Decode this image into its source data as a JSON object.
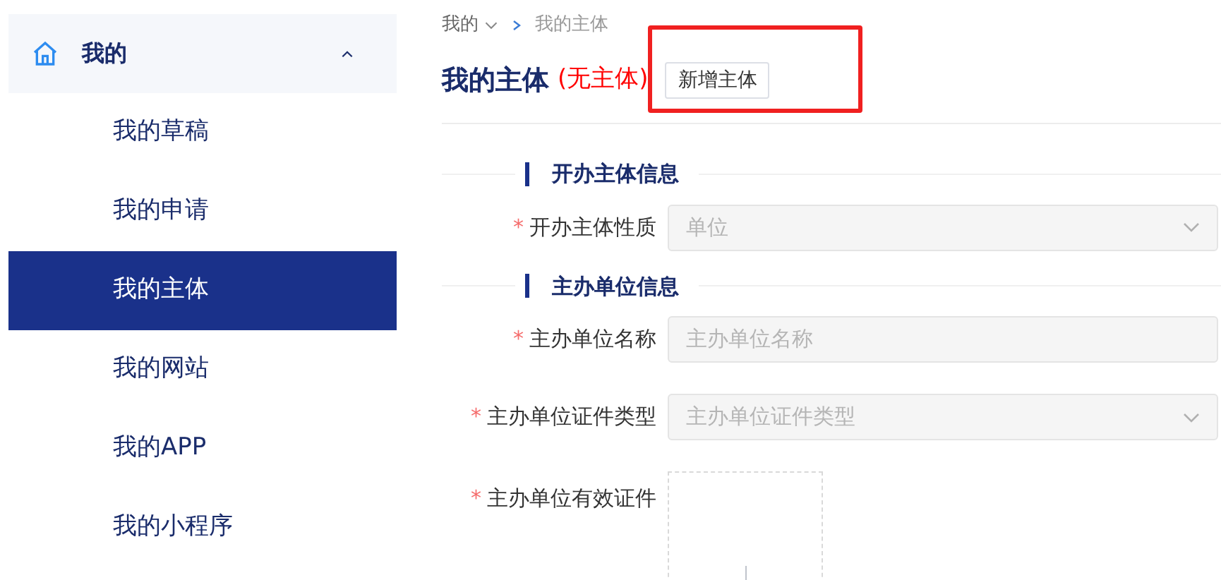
{
  "sidebar": {
    "group": {
      "label": "我的",
      "expanded": true
    },
    "items": [
      {
        "label": "我的草稿",
        "selected": false
      },
      {
        "label": "我的申请",
        "selected": false
      },
      {
        "label": "我的主体",
        "selected": true
      },
      {
        "label": "我的网站",
        "selected": false
      },
      {
        "label": "我的APP",
        "selected": false
      },
      {
        "label": "我的小程序",
        "selected": false
      }
    ]
  },
  "breadcrumb": [
    "我的",
    "我的主体"
  ],
  "title": "我的主体",
  "status": "(无主体)",
  "add_button": {
    "label": "新增主体",
    "highlighted": true
  },
  "sections": [
    {
      "heading": "开办主体信息",
      "fields": [
        {
          "kind": "select",
          "label": "开办主体性质",
          "required_mark": "*",
          "value": "单位"
        }
      ]
    },
    {
      "heading": "主办单位信息",
      "fields": [
        {
          "kind": "input",
          "label": "主办单位名称",
          "required_mark": "*",
          "placeholder": "主办单位名称"
        },
        {
          "kind": "select",
          "label": "主办单位证件类型",
          "required_mark": "*",
          "placeholder": "主办单位证件类型"
        },
        {
          "kind": "upload",
          "label": "主办单位有效证件",
          "required_mark": "*"
        }
      ]
    }
  ]
}
